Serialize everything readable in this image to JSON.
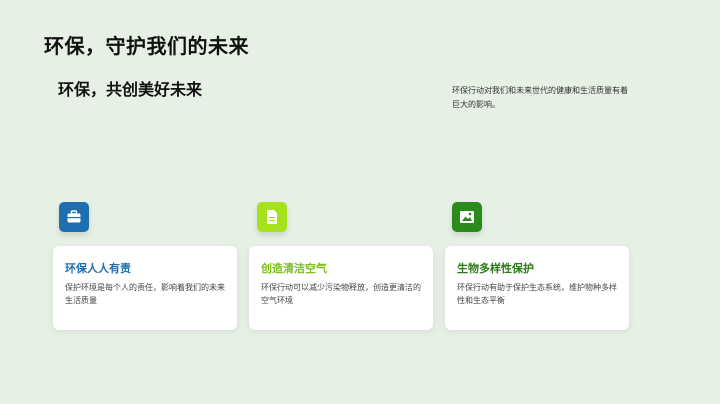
{
  "slide": {
    "title": "环保，守护我们的未来",
    "subtitle": "环保，共创美好未来",
    "intro": "环保行动对我们和未来世代的健康和生活质量有着巨大的影响。"
  },
  "cards": [
    {
      "title": "环保人人有责",
      "text": "保护环境是每个人的责任，影响着我们的未来生活质量",
      "icon": "briefcase-icon",
      "accent": "#1f6fb0",
      "title_color": "#1f6fb0"
    },
    {
      "title": "创造清洁空气",
      "text": "环保行动可以减少污染物释放，创造更清洁的空气环境",
      "icon": "document-icon",
      "accent": "#a6e21c",
      "title_color": "#7cc11a"
    },
    {
      "title": "生物多样性保护",
      "text": "环保行动有助于保护生态系统，维护物种多样性和生态平衡",
      "icon": "image-icon",
      "accent": "#2c8a1c",
      "title_color": "#2c7a1a"
    }
  ]
}
